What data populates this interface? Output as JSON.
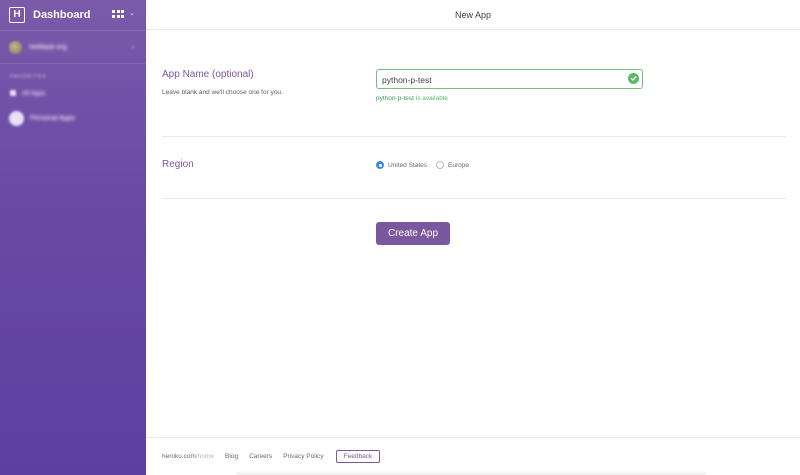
{
  "sidebar": {
    "title": "Dashboard",
    "logo_letter": "H",
    "apps_menu_caret": "⌄",
    "account": {
      "name": "heliflask-org",
      "caret": "⌄"
    },
    "section_label": "FAVORITES",
    "items": [
      {
        "label": "All Apps"
      }
    ],
    "personal": {
      "label": "Personal Apps"
    }
  },
  "header": {
    "title": "New App"
  },
  "app_name": {
    "label": "App Name (optional)",
    "hint": "Leave blank and we'll choose one for you.",
    "value": "python-p-test",
    "available_name": "python-p-test",
    "available_suffix": " is available"
  },
  "region": {
    "label": "Region",
    "options": [
      {
        "label": "United States",
        "selected": true
      },
      {
        "label": "Europe",
        "selected": false
      }
    ]
  },
  "create_button": {
    "label": "Create App"
  },
  "footer": {
    "domain_main": "heroku.com",
    "domain_path": "/home",
    "links": [
      "Blog",
      "Careers",
      "Privacy Policy"
    ],
    "feedback_label": "Feedback"
  },
  "colors": {
    "brand_purple": "#79589f",
    "success_green": "#59b96a",
    "radio_blue": "#3b8be0"
  }
}
